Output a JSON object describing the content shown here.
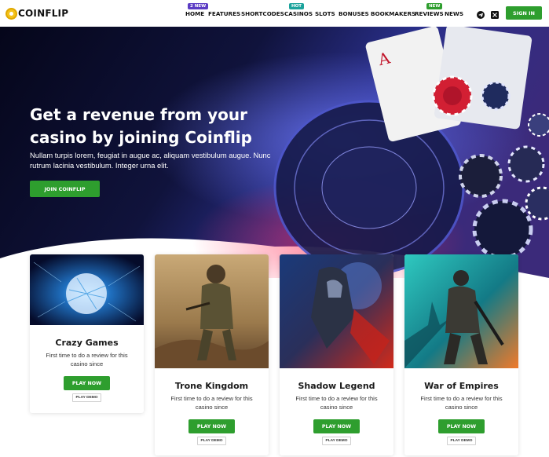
{
  "header": {
    "logo_text": "COINFLIP",
    "nav": [
      {
        "label": "HOME",
        "badge": "2 NEW",
        "badge_color": "#5b3cc4"
      },
      {
        "label": "FEATURES"
      },
      {
        "label": "SHORTCODES"
      },
      {
        "label": "CASINOS",
        "badge": "HOT",
        "badge_color": "#1ba39c"
      },
      {
        "label": "SLOTS"
      },
      {
        "label": "BONUSES"
      },
      {
        "label": "BOOKMAKERS"
      },
      {
        "label": "REVIEWS",
        "badge": "NEW",
        "badge_color": "#2e9e2e"
      },
      {
        "label": "NEWS"
      }
    ],
    "icons": [
      "telegram-icon",
      "x-twitter-icon"
    ],
    "signin_label": "SIGN IN"
  },
  "hero": {
    "title": "Get a revenue from your casino by joining Coinflip",
    "subtitle": "Nullam turpis lorem, feugiat in augue ac, aliquam vestibulum augue. Nunc rutrum lacinia vestibulum. Integer urna elit.",
    "cta_label": "JOIN COINFLIP"
  },
  "cards": [
    {
      "title": "Crazy Games",
      "description": "First time to do a review for this casino since",
      "play_now": "PLAY NOW",
      "play_demo": "PLAY DEMO"
    },
    {
      "title": "Trone Kingdom",
      "description": "First time to do a review for this casino since",
      "play_now": "PLAY NOW",
      "play_demo": "PLAY DEMO"
    },
    {
      "title": "Shadow Legend",
      "description": "First time to do a review for this casino since",
      "play_now": "PLAY NOW",
      "play_demo": "PLAY DEMO"
    },
    {
      "title": "War of Empires",
      "description": "First time to do a review for this casino since",
      "play_now": "PLAY NOW",
      "play_demo": "PLAY DEMO"
    }
  ],
  "colors": {
    "accent_green": "#2e9e2e",
    "hero_dark": "#0b0b22",
    "logo_gold": "#f4c21a"
  }
}
